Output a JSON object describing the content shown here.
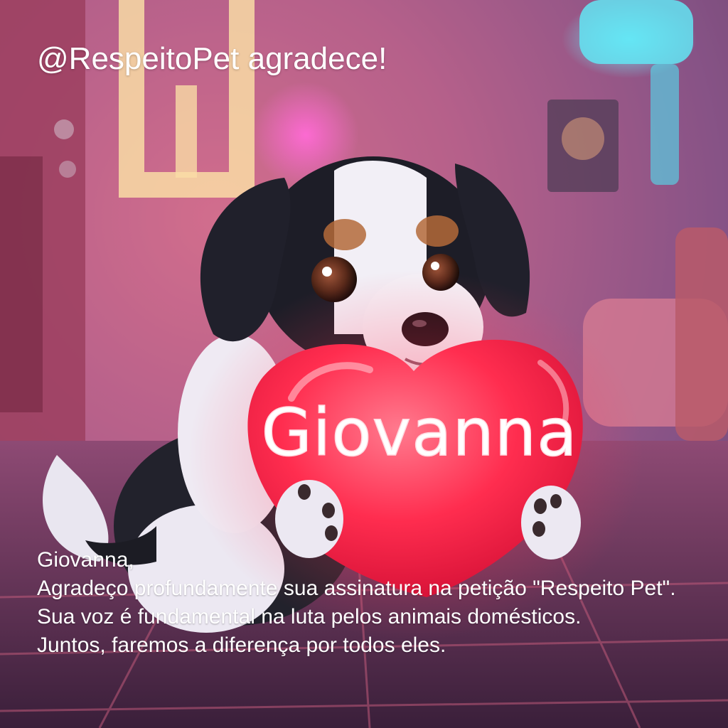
{
  "headline": "@RespeitoPet agradece!",
  "heart_text": "Giovanna",
  "message": {
    "greeting": "Giovanna,",
    "line1": "Agradeço profundamente sua assinatura na petição \"Respeito Pet\".",
    "line2": "Sua voz é fundamental na luta pelos animais domésticos.",
    "line3": "Juntos, faremos a diferença por todos eles."
  },
  "colors": {
    "heart": "#ff2d4f",
    "text": "#ffffff",
    "neon_yellow": "#ffe9a8",
    "neon_cyan": "#6ff0ff",
    "neon_pink": "#ff6ad5"
  }
}
